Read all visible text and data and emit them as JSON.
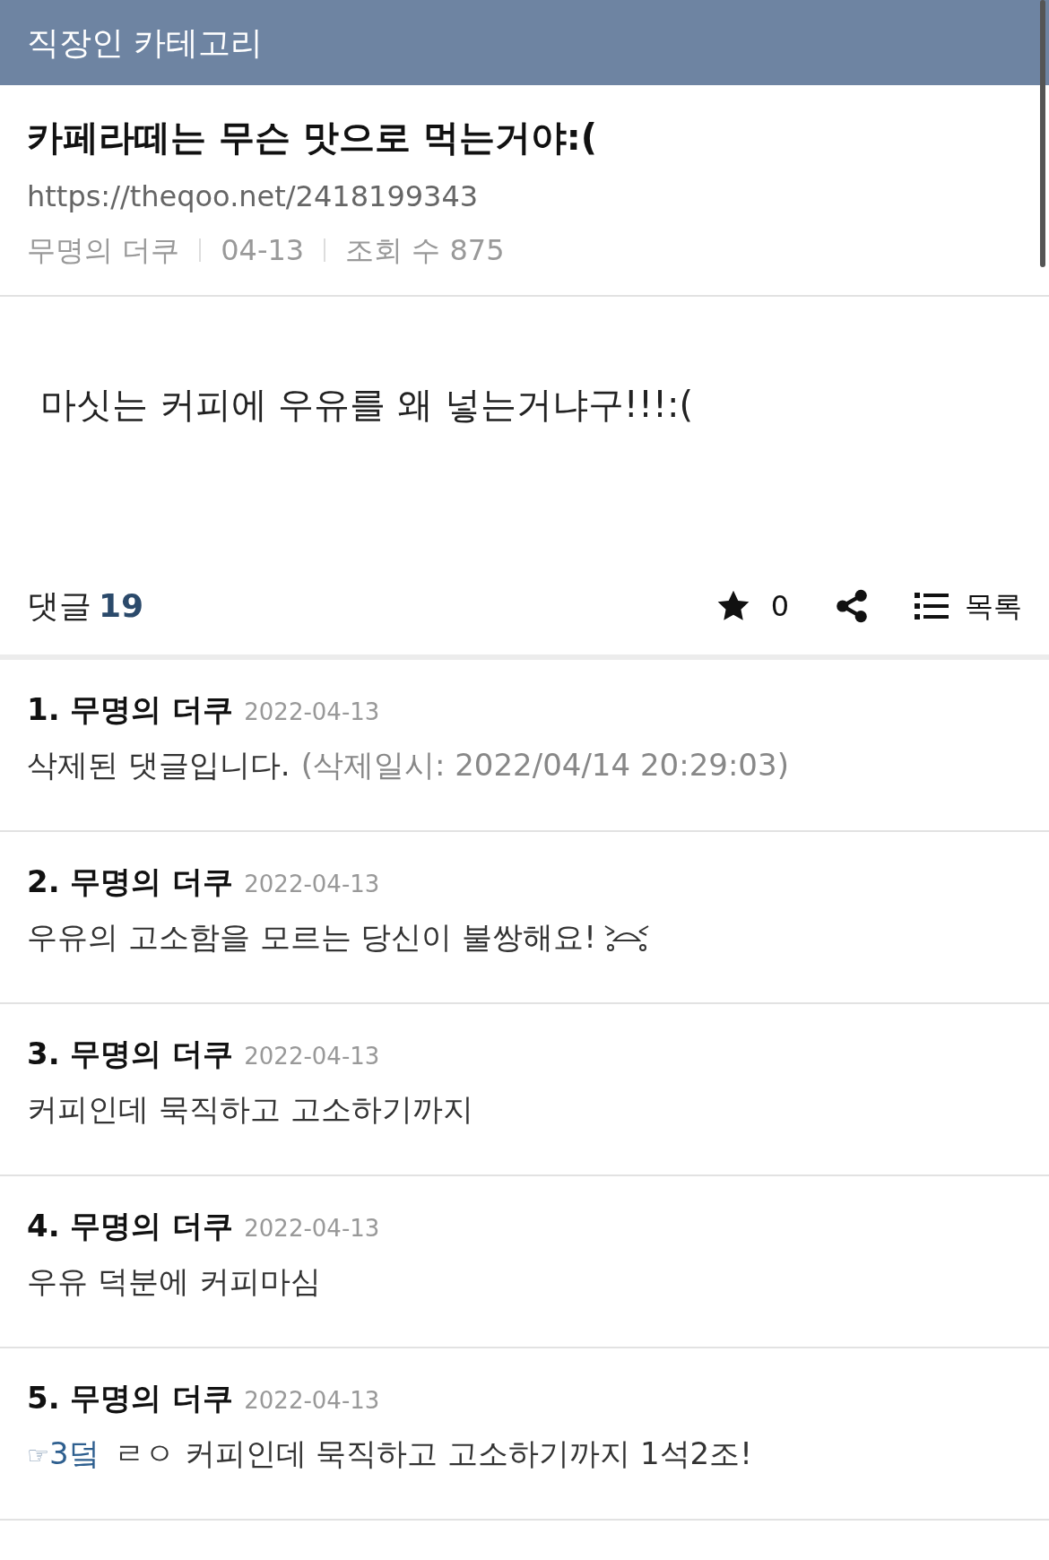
{
  "header": {
    "title": "직장인 카테고리"
  },
  "post": {
    "title": "카페라떼는 무슨 맛으로 먹는거야:(",
    "url": "https://theqoo.net/2418199343",
    "meta": [
      "무명의 더쿠",
      "04-13",
      "조회 수 875"
    ],
    "body": "마싯는 커피에 우유를 왜 넣는거냐구!!!:("
  },
  "actions": {
    "comments_label": "댓글",
    "comments_count": "19",
    "star_count": "0",
    "list_label": "목록"
  },
  "comments": [
    {
      "kind": "deleted",
      "author": "1. 무명의 더쿠",
      "date": "2022-04-13",
      "text": "삭제된 댓글입니다.",
      "note": "(삭제일시: 2022/04/14 20:29:03)"
    },
    {
      "kind": "emoticon",
      "author": "2. 무명의 더쿠",
      "date": "2022-04-13",
      "text": "우유의 고소함을 모르는 당신이 불쌍해요!"
    },
    {
      "kind": "plain",
      "author": "3. 무명의 더쿠",
      "date": "2022-04-13",
      "text": "커피인데 묵직하고 고소하기까지"
    },
    {
      "kind": "plain",
      "author": "4. 무명의 더쿠",
      "date": "2022-04-13",
      "text": "우유 덕분에 커피마심"
    },
    {
      "kind": "reply",
      "author": "5. 무명의 더쿠",
      "date": "2022-04-13",
      "pointer": "☞",
      "reply_to": "3덬",
      "text": "ㄹㅇ 커피인데 묵직하고 고소하기까지 1석2조!"
    }
  ]
}
